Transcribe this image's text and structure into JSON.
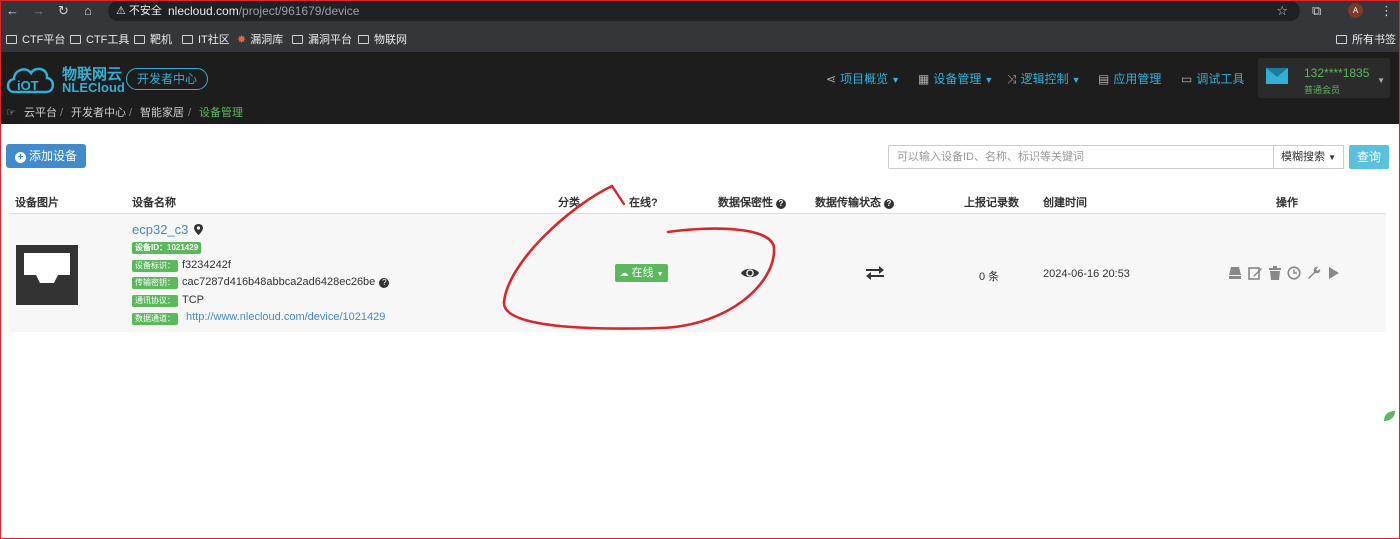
{
  "browser": {
    "security_label": "不安全",
    "url_host": "nlecloud.com",
    "url_path": "/project/961679/device",
    "profile_initial": "A",
    "bookmarks": [
      "CTF平台",
      "CTF工具",
      "靶机",
      "IT社区",
      "漏洞库",
      "漏洞平台",
      "物联网"
    ],
    "bookmarks_right": "所有书签"
  },
  "header": {
    "logo_cn": "物联网云",
    "logo_en": "NLECloud",
    "dev_center": "开发者中心",
    "menu": [
      "项目概览",
      "设备管理",
      "逻辑控制",
      "应用管理",
      "调试工具"
    ],
    "user_id": "132****1835",
    "user_level": "普通会员"
  },
  "breadcrumb": [
    "云平台",
    "开发者中心",
    "智能家居",
    "设备管理"
  ],
  "toolbar": {
    "add_label": "添加设备",
    "search_placeholder": "可以输入设备ID、名称、标识等关键词",
    "search_mode": "模糊搜索",
    "query_label": "查询"
  },
  "table": {
    "headers": {
      "image": "设备图片",
      "name": "设备名称",
      "category": "分类",
      "online": "在线?",
      "privacy": "数据保密性",
      "transfer": "数据传输状态",
      "records": "上报记录数",
      "created": "创建时间",
      "actions": "操作"
    },
    "row": {
      "name": "ecp32_c3",
      "device_id_label": "设备ID：1021429",
      "identifier_label": "设备标识：",
      "identifier": "f3234242f",
      "key_label": "传输密钥：",
      "key": "cac7287d416b48abbca2ad6428ec26be",
      "protocol_label": "通讯协议：",
      "protocol": "TCP",
      "url_label": "数据通道：",
      "url": "http://www.nlecloud.com/device/1021429",
      "status": "在线",
      "records": "0 条",
      "created": "2024-06-16 20:53"
    }
  },
  "icons": {
    "actions": [
      "stack-icon",
      "edit-icon",
      "trash-icon",
      "clock-icon",
      "wrench-icon",
      "play-icon"
    ]
  },
  "colors": {
    "accent": "#31b0d5",
    "success": "#5cb85c",
    "primary": "#428bca",
    "annotation": "#d8262b"
  }
}
